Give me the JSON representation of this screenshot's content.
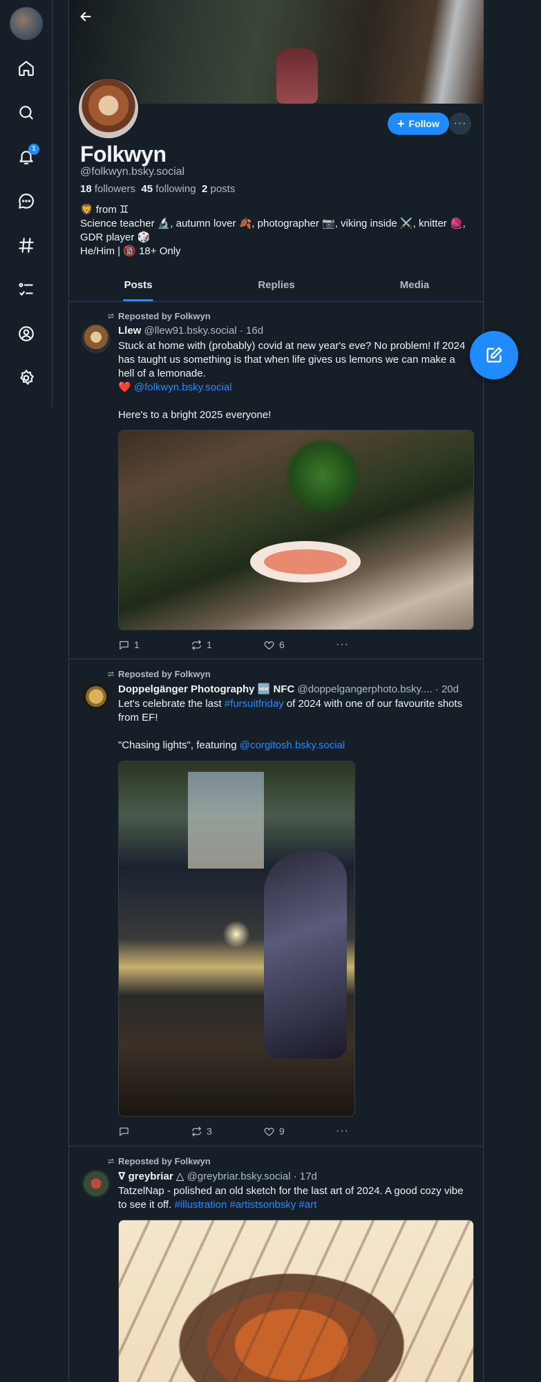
{
  "nav": {
    "items": [
      "home",
      "search",
      "notifications",
      "chat",
      "feeds",
      "lists",
      "profile",
      "settings"
    ],
    "notification_count": "1"
  },
  "profile": {
    "display_name": "Folkwyn",
    "handle": "@folkwyn.bsky.social",
    "followers_count": "18",
    "followers_label": "followers",
    "following_count": "45",
    "following_label": "following",
    "posts_count": "2",
    "posts_label": "posts",
    "follow_label": "Follow",
    "bio": {
      "line1": "🦁 from ♊",
      "line2": "Science teacher 🔬, autumn lover 🍂, photographer 📷, viking inside ⚔️, knitter 🧶, GDR player 🎲",
      "line3": "He/Him | 🔞 18+ Only"
    }
  },
  "tabs": [
    "Posts",
    "Replies",
    "Media"
  ],
  "posts": [
    {
      "repost_label": "Reposted by Folkwyn",
      "author_name": "Llew",
      "author_handle": "@llew91.bsky.social",
      "age": "· 16d",
      "text1": "Stuck at home with (probably) covid at new year's eve? No problem! If 2024 has taught us something is that when life gives us lemons we can make a hell of a lemonade.",
      "heart": "❤️",
      "mention": "@folkwyn.bsky.social",
      "text2": "Here's to a bright 2025 everyone!",
      "replies": "1",
      "reposts": "1",
      "likes": "6"
    },
    {
      "repost_label": "Reposted by Folkwyn",
      "author_name": "Doppelgänger Photography 🆕 NFC",
      "author_handle": "@doppelgangerphoto.bsky....",
      "age": "· 20d",
      "text1_a": "Let's celebrate the last ",
      "hashtag": "#fursuitfriday",
      "text1_b": " of 2024 with one of our favourite shots from EF!",
      "text2_a": "\"Chasing lights\", featuring ",
      "mention": "@corgitosh.bsky.social",
      "replies": "",
      "reposts": "3",
      "likes": "9"
    },
    {
      "repost_label": "Reposted by Folkwyn",
      "author_name": "∇ greybriar △",
      "author_handle": "@greybriar.bsky.social",
      "age": "· 17d",
      "text_a": "TatzelNap - polished an old sketch for the last art of 2024. A good cozy vibe to see it off. ",
      "tags": "#illustration #artistsonbsky #art"
    }
  ]
}
